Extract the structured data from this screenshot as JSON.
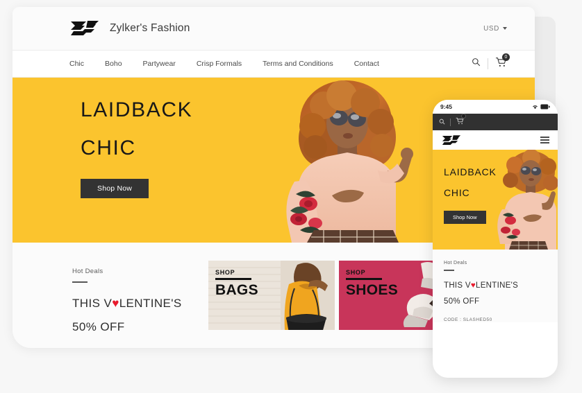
{
  "brand": {
    "name": "Zylker's Fashion",
    "logo_icon": "zylker-logo-icon"
  },
  "desktop": {
    "header": {
      "currency": "USD",
      "currency_caret_icon": "chevron-down-icon"
    },
    "nav": {
      "items": [
        {
          "label": "Chic"
        },
        {
          "label": "Boho"
        },
        {
          "label": "Partywear"
        },
        {
          "label": "Crisp Formals"
        },
        {
          "label": "Terms and Conditions"
        },
        {
          "label": "Contact"
        }
      ],
      "search_icon": "search-icon",
      "cart_icon": "shopping-cart-icon",
      "cart_count": "0"
    },
    "hero": {
      "line1": "LAIDBACK",
      "line2": "CHIC",
      "cta": "Shop Now",
      "bg_color": "#fbc42e",
      "model_alt": "woman-in-pink-floral-sweater"
    },
    "deals": {
      "kicker": "Hot Deals",
      "line1_pre": "THIS V",
      "line1_heart": "♥",
      "line1_post": "LENTINE'S",
      "line2": "50% OFF",
      "heart_color": "#e8192c"
    },
    "cards": [
      {
        "shop": "SHOP",
        "title": "BAGS",
        "bg_color": "#e9e2d9",
        "image_alt": "woman-with-black-handbag"
      },
      {
        "shop": "SHOP",
        "title": "SHOES",
        "bg_color": "#c8355a",
        "image_alt": "high-heel-shoes"
      }
    ]
  },
  "phone": {
    "status": {
      "time": "9:45",
      "wifi_icon": "wifi-icon",
      "battery_icon": "battery-icon"
    },
    "toolbar": {
      "search_icon": "search-icon",
      "cart_icon": "shopping-cart-icon",
      "cart_count": ""
    },
    "brandbar": {
      "logo_icon": "zylker-logo-icon",
      "menu_icon": "hamburger-menu-icon"
    },
    "hero": {
      "line1": "LAIDBACK",
      "line2": "CHIC",
      "cta": "Shop Now",
      "bg_color": "#fbc42e"
    },
    "deals": {
      "kicker": "Hot Deals",
      "line1_pre": "THIS V",
      "line1_heart": "♥",
      "line1_post": "LENTINE'S",
      "line2": "50% OFF",
      "code": "CODE : SLASHED50"
    }
  }
}
